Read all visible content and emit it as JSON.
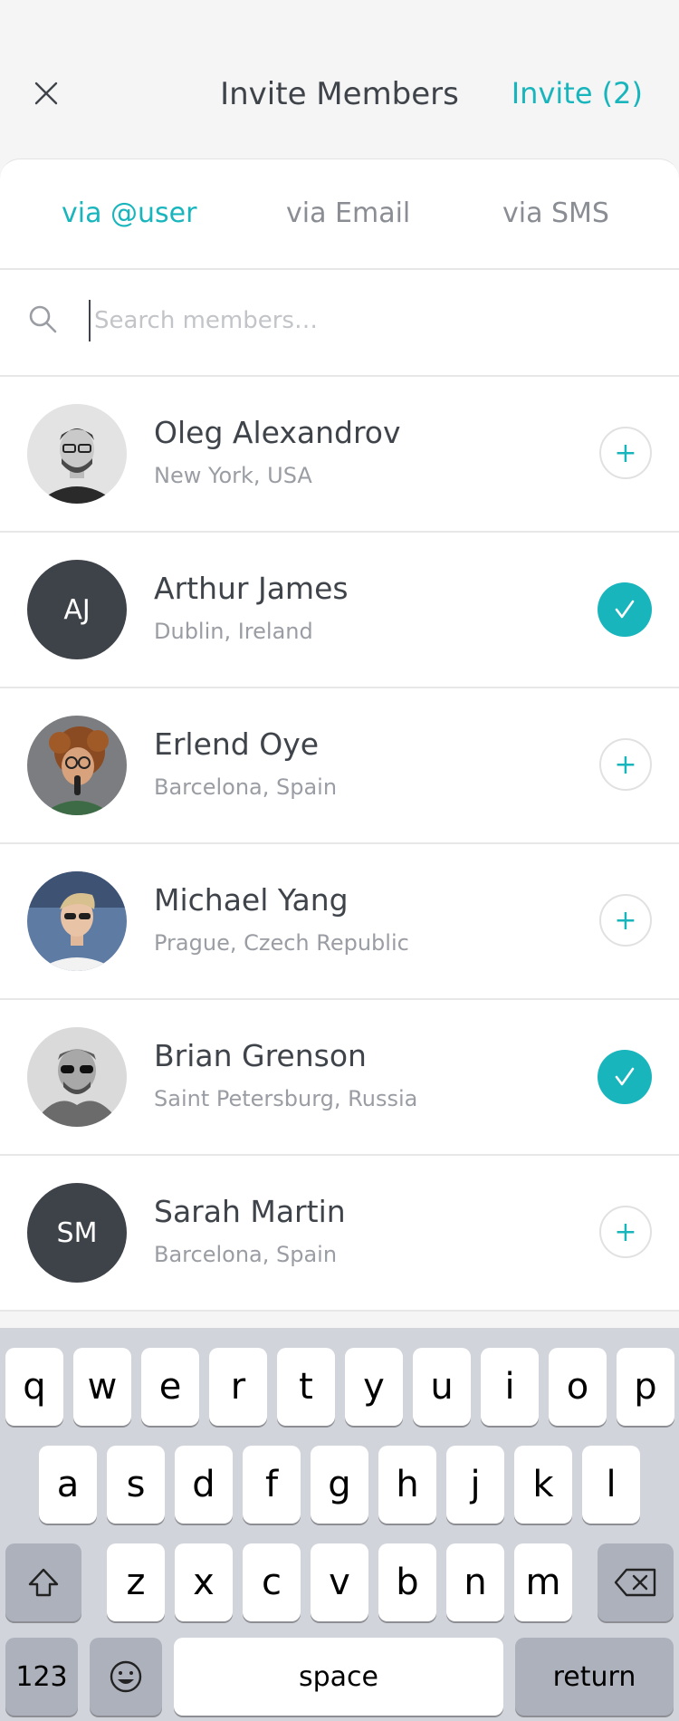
{
  "header": {
    "title": "Invite Members",
    "invite_label": "Invite (2)"
  },
  "tabs": [
    {
      "label": "via @user",
      "active": true
    },
    {
      "label": "via Email",
      "active": false
    },
    {
      "label": "via SMS",
      "active": false
    }
  ],
  "search": {
    "placeholder": "Search members…",
    "value": ""
  },
  "members": [
    {
      "name": "Oleg Alexandrov",
      "location": "New York, USA",
      "selected": false,
      "avatar": "photo"
    },
    {
      "name": "Arthur James",
      "location": "Dublin, Ireland",
      "selected": true,
      "avatar": "initials",
      "initials": "AJ"
    },
    {
      "name": "Erlend Oye",
      "location": "Barcelona, Spain",
      "selected": false,
      "avatar": "photo"
    },
    {
      "name": "Michael Yang",
      "location": "Prague, Czech Republic",
      "selected": false,
      "avatar": "photo"
    },
    {
      "name": "Brian Grenson",
      "location": "Saint Petersburg, Russia",
      "selected": true,
      "avatar": "photo"
    },
    {
      "name": "Sarah Martin",
      "location": "Barcelona, Spain",
      "selected": false,
      "avatar": "initials",
      "initials": "SM"
    }
  ],
  "keyboard": {
    "row1": [
      "q",
      "w",
      "e",
      "r",
      "t",
      "y",
      "u",
      "i",
      "o",
      "p"
    ],
    "row2": [
      "a",
      "s",
      "d",
      "f",
      "g",
      "h",
      "j",
      "k",
      "l"
    ],
    "row3": [
      "z",
      "x",
      "c",
      "v",
      "b",
      "n",
      "m"
    ],
    "numbers_label": "123",
    "space_label": "space",
    "return_label": "return"
  },
  "colors": {
    "accent": "#19b5bd",
    "avatar_bg": "#3e434a",
    "text": "#3f434a",
    "muted": "#9a9da3"
  },
  "icons": {
    "close": "close-icon",
    "search": "search-icon",
    "add": "plus-icon",
    "check": "check-icon",
    "shift": "shift-icon",
    "backspace": "backspace-icon",
    "emoji": "emoji-icon"
  }
}
